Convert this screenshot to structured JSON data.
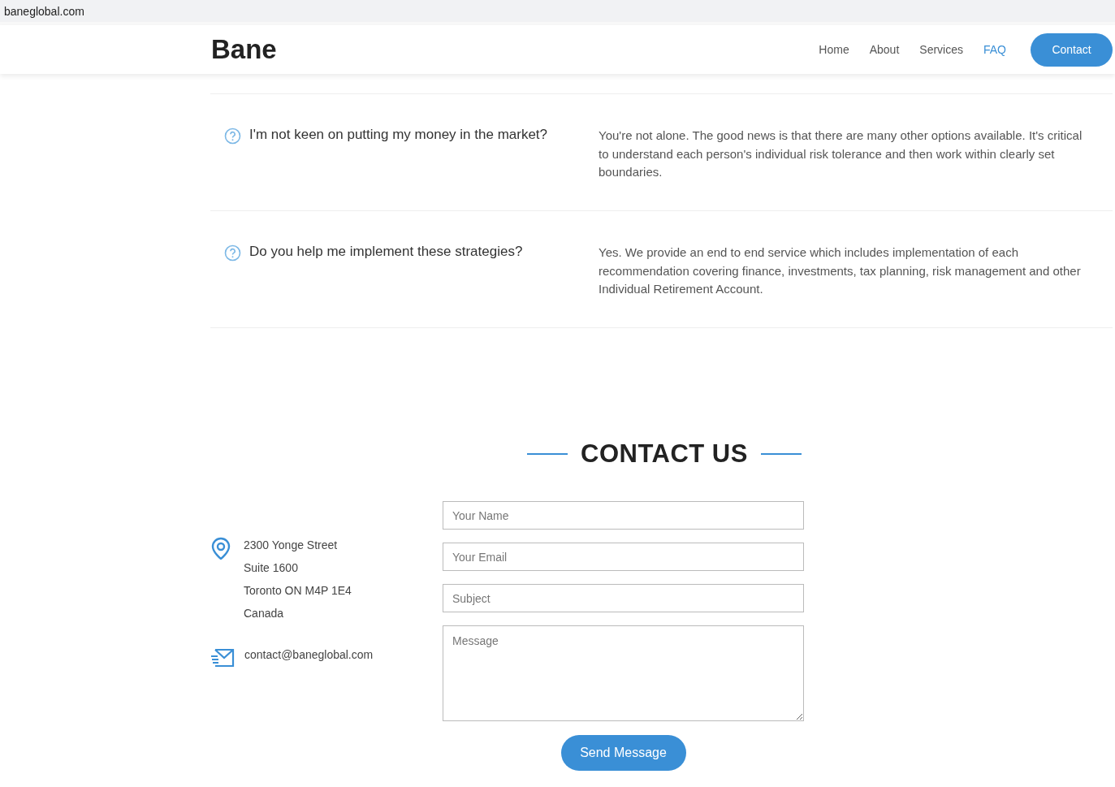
{
  "browser": {
    "url": "baneglobal.com"
  },
  "header": {
    "logo": "Bane",
    "nav": [
      {
        "label": "Home",
        "selected": false
      },
      {
        "label": "About",
        "selected": false
      },
      {
        "label": "Services",
        "selected": false
      },
      {
        "label": "FAQ",
        "selected": true
      }
    ],
    "cta": "Contact"
  },
  "faq": [
    {
      "question": "I'm not keen on putting my money in the market?",
      "answer": "You're not alone. The good news is that there are many other options available. It's critical to understand each person's individual risk tolerance and then work within clearly set boundaries."
    },
    {
      "question": "Do you help me implement these strategies?",
      "answer": "Yes. We provide an end to end service which includes implementation of each recommendation covering finance, investments, tax planning, risk management and other Individual Retirement Account."
    }
  ],
  "contact": {
    "title": "CONTACT US",
    "address": [
      "2300 Yonge Street",
      "Suite 1600",
      "Toronto ON M4P 1E4",
      "Canada"
    ],
    "email": "contact@baneglobal.com",
    "fields": [
      {
        "kind": "input",
        "placeholder": "Your Name"
      },
      {
        "kind": "input",
        "placeholder": "Your Email"
      },
      {
        "kind": "input",
        "placeholder": "Subject"
      },
      {
        "kind": "textarea",
        "placeholder": "Message"
      }
    ],
    "submit": "Send Message"
  }
}
